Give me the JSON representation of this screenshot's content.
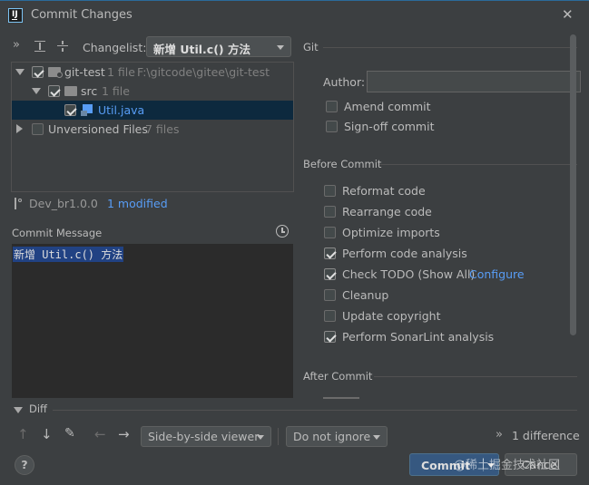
{
  "window": {
    "title": "Commit Changes",
    "close_glyph": "✕"
  },
  "toolbar": {
    "changelist_label": "Changelist:",
    "changelist_value": "新增 Util.c() 方法"
  },
  "tree": {
    "root": {
      "name": "git-test",
      "count": "1 file",
      "path": "F:\\gitcode\\gitee\\git-test"
    },
    "folder": {
      "name": "src",
      "count": "1 file"
    },
    "file": {
      "name": "Util.java"
    },
    "unversioned": {
      "name": "Unversioned Files",
      "count": "7 files"
    }
  },
  "status": {
    "branch": "Dev_br1.0.0",
    "modified": "1 modified"
  },
  "commit_message": {
    "label": "Commit Message",
    "text": "新增 Util.c() 方法"
  },
  "git": {
    "section": "Git",
    "author_label": "Author:",
    "author_value": "",
    "options": [
      {
        "label": "Amend commit",
        "checked": false
      },
      {
        "label": "Sign-off commit",
        "checked": false
      }
    ]
  },
  "before_commit": {
    "section": "Before Commit",
    "options": [
      {
        "label": "Reformat code",
        "checked": false
      },
      {
        "label": "Rearrange code",
        "checked": false
      },
      {
        "label": "Optimize imports",
        "checked": false
      },
      {
        "label": "Perform code analysis",
        "checked": true
      },
      {
        "label": "Check TODO (Show All)",
        "checked": true,
        "link": "Configure"
      },
      {
        "label": "Cleanup",
        "checked": false
      },
      {
        "label": "Update copyright",
        "checked": false
      },
      {
        "label": "Perform SonarLint analysis",
        "checked": true
      }
    ]
  },
  "after_commit": {
    "section": "After Commit"
  },
  "diff": {
    "label": "Diff",
    "viewer": "Side-by-side viewer",
    "ignore": "Do not ignore",
    "differences": "1 difference",
    "expand_glyph": "»"
  },
  "footer": {
    "help": "?",
    "commit": "Commit",
    "cancel": "Cancel",
    "watermark": "@稀土掘金技术社区"
  },
  "colors": {
    "accent": "#365880",
    "link": "#589df6",
    "selection": "#0d293e",
    "primary_button": "#365880"
  }
}
